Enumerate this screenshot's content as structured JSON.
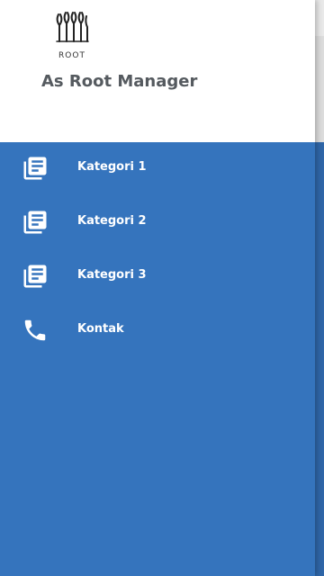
{
  "header": {
    "logo_text": "ROOT",
    "app_name": "As Root Manager"
  },
  "menu": {
    "items": [
      {
        "label": "Kategori 1",
        "icon": "library-books-icon"
      },
      {
        "label": "Kategori 2",
        "icon": "library-books-icon"
      },
      {
        "label": "Kategori 3",
        "icon": "library-books-icon"
      },
      {
        "label": "Kontak",
        "icon": "phone-icon"
      }
    ]
  },
  "colors": {
    "drawer_background": "#3574bd",
    "header_background": "#ffffff",
    "app_name_text": "#555a5f",
    "menu_text": "#ffffff"
  }
}
